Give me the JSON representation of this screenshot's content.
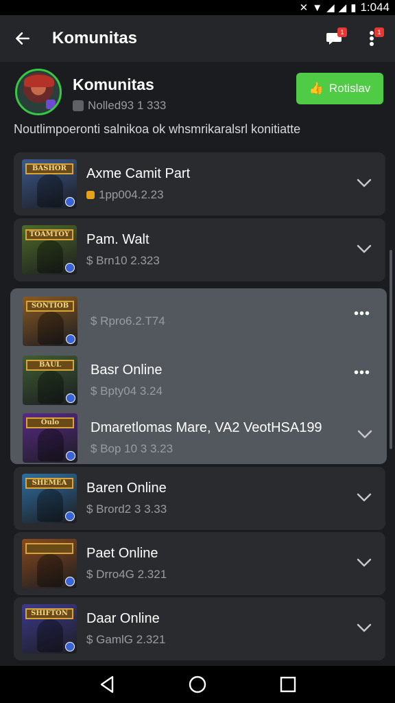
{
  "status_bar": {
    "time": "1:044"
  },
  "app_bar": {
    "title": "Komunitas",
    "chat_badge": "1",
    "menu_badge": "1"
  },
  "header": {
    "name": "Komunitas",
    "meta": "Nolled93 1 333",
    "join_label": "Rotislav"
  },
  "description": "Noutlimpoeronti salnikoa ok whsmrikaralsrl konitiatte",
  "games": [
    {
      "name": "Axme Camit Part",
      "sub": "1pp004.2.23",
      "thumb_label": "BASHOR",
      "thumb_color": "#3c5a8c"
    },
    {
      "name": "Pam. Walt",
      "sub": "$ Brn10 2.323",
      "thumb_label": "TOAMTOY",
      "thumb_color": "#4e6b26"
    }
  ],
  "group_items": [
    {
      "name": "",
      "sub": "$ Rpro6.2.T74",
      "thumb_label": "SONTIOB",
      "thumb_color": "#8a5a20",
      "action": "more"
    },
    {
      "name": "Basr Online",
      "sub": "$ Bpty04 3.24",
      "thumb_label": "BAUL",
      "thumb_color": "#3e5e30",
      "action": "more"
    },
    {
      "name": "Dmaretlomas Mare, VA2 VeotHSA199",
      "sub": "$ Bop 10 3 3.23",
      "thumb_label": "Oulo",
      "thumb_color": "#5a2a86",
      "action": "chevron"
    }
  ],
  "games_below": [
    {
      "name": "Baren Online",
      "sub": "$ Brord2 3 3.33",
      "thumb_label": "SHEMEA",
      "thumb_color": "#2f6fa0"
    },
    {
      "name": "Paet Online",
      "sub": "$ Drro4G 2.321",
      "thumb_label": "",
      "thumb_color": "#8a4a1c"
    },
    {
      "name": "Daar Online",
      "sub": "$ GamlG 2.321",
      "thumb_label": "SHIFTON",
      "thumb_color": "#3d3a8c"
    }
  ]
}
